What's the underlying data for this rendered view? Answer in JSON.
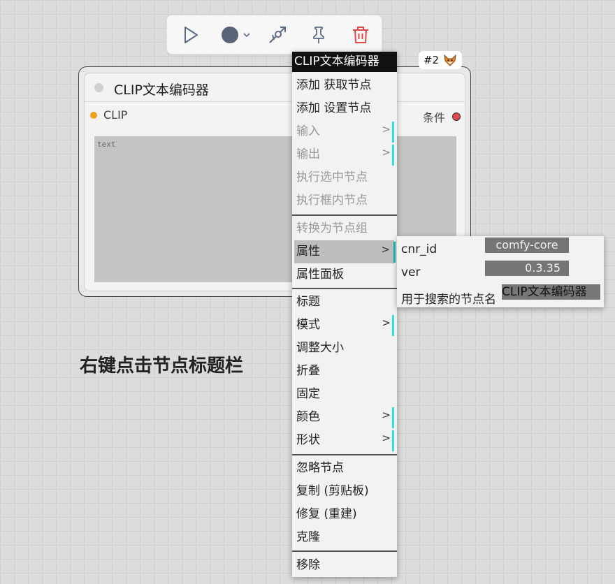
{
  "toolbar": {
    "buttons": [
      {
        "name": "run",
        "icon": "play-icon"
      },
      {
        "name": "color",
        "icon": "color-circle-icon"
      },
      {
        "name": "bypass",
        "icon": "link-arrow-icon"
      },
      {
        "name": "pin",
        "icon": "pin-icon"
      },
      {
        "name": "delete",
        "icon": "trash-icon"
      }
    ]
  },
  "node": {
    "title": "CLIP文本编码器",
    "input_label": "CLIP",
    "output_label": "条件",
    "textarea_placeholder": "text",
    "badge_text": "#2",
    "badge_icon": "fox-icon"
  },
  "menu": {
    "title": "CLIP文本编码器",
    "items": [
      {
        "label": "添加 获取节点"
      },
      {
        "label": "添加 设置节点"
      },
      {
        "label": "输入",
        "submenu": true,
        "disabled": true
      },
      {
        "label": "输出",
        "submenu": true,
        "disabled": true
      },
      {
        "label": "执行选中节点",
        "disabled": true
      },
      {
        "label": "执行框内节点",
        "disabled": true
      },
      {
        "label": "转换为节点组",
        "disabled": true
      },
      {
        "label": "属性",
        "submenu": true,
        "highlighted": true
      },
      {
        "label": "属性面板"
      },
      {
        "label": "标题"
      },
      {
        "label": "模式",
        "submenu": true
      },
      {
        "label": "调整大小"
      },
      {
        "label": "折叠"
      },
      {
        "label": "固定"
      },
      {
        "label": "颜色",
        "submenu": true
      },
      {
        "label": "形状",
        "submenu": true
      },
      {
        "label": "忽略节点"
      },
      {
        "label": "复制 (剪贴板)"
      },
      {
        "label": "修复 (重建)"
      },
      {
        "label": "克隆"
      },
      {
        "label": "移除"
      }
    ],
    "arrow": ">"
  },
  "properties": [
    {
      "name": "cnr_id",
      "value": "comfy-core"
    },
    {
      "name": "ver",
      "value": "0.3.35"
    },
    {
      "name": "用于搜索的节点名",
      "value": "CLIP文本编码器"
    }
  ],
  "caption": "右键点击节点标题栏",
  "colors": {
    "delete_red": "#e04848",
    "color_dot": "#5a6478",
    "accent_cyan": "#2ee0e0",
    "input_orange": "#f0a020"
  }
}
